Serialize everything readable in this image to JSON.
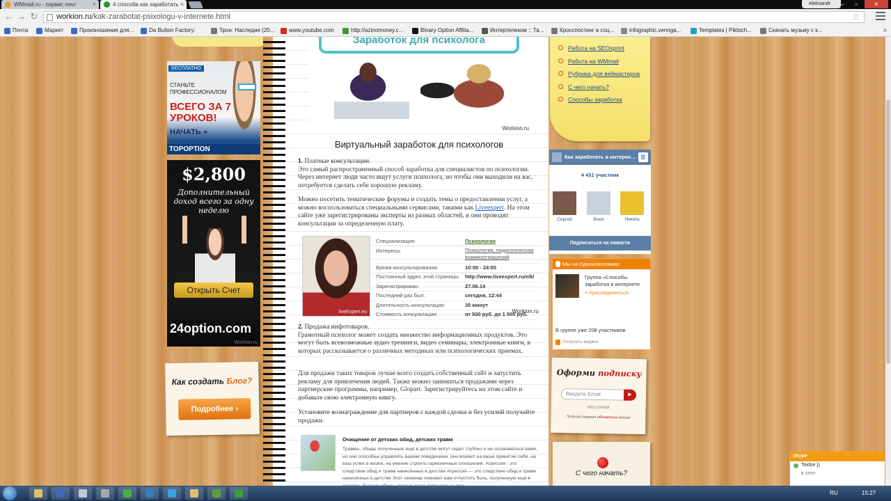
{
  "browser": {
    "tabs": [
      {
        "label": "WMmail.ru - сервис почт",
        "fav_color": "#e8a030"
      },
      {
        "label": "4 способа как заработать",
        "fav_color": "#2a9a2a"
      }
    ],
    "user": "Aleksandr",
    "window_buttons": [
      "—",
      "▫",
      "✕"
    ],
    "url_domain": "workion.ru",
    "url_path": "/kak-zarabotat-psixologu-v-internete.html",
    "bookmarks": [
      {
        "label": "Почта",
        "color": "#3b6cb8"
      },
      {
        "label": "Маркет",
        "color": "#3b6cb8"
      },
      {
        "label": "Произношения для...",
        "color": "#3b6cb8"
      },
      {
        "label": "Da Button Factory:",
        "color": "#3b6cb8"
      },
      {
        "label": "Трон: Наследие (20...",
        "color": "#777777"
      },
      {
        "label": "www.youtube.com",
        "color": "#d82a20"
      },
      {
        "label": "http://azinomoney.c...",
        "color": "#3a9a3a"
      },
      {
        "label": "Binary Option Affilia...",
        "color": "#111111"
      },
      {
        "label": "Интертелеком :: Та...",
        "color": "#555555"
      },
      {
        "label": "Кросспостинг в соц...",
        "color": "#777777"
      },
      {
        "label": "infographic.vennga...",
        "color": "#888888"
      },
      {
        "label": "Templates | Piktoch...",
        "color": "#20a0c0"
      },
      {
        "label": "Скачать музыку с к...",
        "color": "#777777"
      }
    ],
    "bookmarks_more": "»"
  },
  "left": {
    "edu_banner": {
      "tag": "БЕСПЛАТНО",
      "line1": "СТАНЬТЕ ПРОФЕССИОНАЛОМ",
      "line2": "ВСЕГО ЗА 7 УРОКОВ!",
      "line3": "НАЧАТЬ »",
      "logo": "TOPOPTION"
    },
    "option_banner": {
      "amount": "$2,800",
      "sub": "Дополнительный доход всего за одну неделю",
      "button": "Открыть Счет",
      "logo": "24option.com",
      "watermark": "Workion.ru"
    },
    "blog_note": {
      "title_a": "Как создать ",
      "title_b": "Блог?",
      "button": "Подробнее ›"
    }
  },
  "hero": {
    "sign": "Заработок для психолога",
    "caption": "Workion.ru"
  },
  "article": {
    "title": "Виртуальный заработок для психологов",
    "s1_num": "1.",
    "s1_head": " Платные консультации.",
    "s1_text": "Это самый распространенный способ заработка для специалистов по психологии. Через интернет люди часто ищут услуги психолога, но чтобы они выходили на вас, потребуется сделать себе хорошую рекламу.",
    "p2_a": "Можно посетить тематические форумы и создать темы о предоставлении услуг, а можно воспользоваться специальными сервисами, такими как ",
    "p2_link": "Liveexpert",
    "p2_b": ". На этом сайте уже зарегистрированы эксперты из разных областей, и они проводят консультации за определенную плату.",
    "s2_num": "2.",
    "s2_head": " Продажа инфотоваров.",
    "s2_text": "Грамотный психолог может создать множество информационных продуктов. Это могут быть всевозможные аудио тренинги, видео семинары, электронные книги, в которых рассказывается о различных методиках или психологических приемах.",
    "p4": "Для продажи таких товаров лучше всего создать собственный сайт и запустить рекламу для привлечения людей. Также можно заниматься продажами через партнерские программы, например, Glopart. Зарегистрируйтесь на этом сайте и добавьте свою электронную книгу.",
    "p5": "Установите вознаграждение для партнеров с каждой сделки и без усилий получайте продажи."
  },
  "profile": {
    "photo_label": "liveExpert.eu",
    "watermark": "Workion.ru",
    "rows": [
      {
        "k": "Специализация:",
        "v": "Психология"
      },
      {
        "k": "Интересы:",
        "v": "Психология, педагогическая взаимоотношений"
      },
      {
        "k": "Время консультирования:",
        "v": "10:00 - 24:00"
      },
      {
        "k": "Постоянный адрес этой страницы:",
        "v": "http://www.liveexpert.ru/e/kl"
      },
      {
        "k": "Зарегистрирован:",
        "v": "27.06.14"
      },
      {
        "k": "Последний раз был:",
        "v": "сегодня, 12:44"
      },
      {
        "k": "Длительность консультации:",
        "v": "30 минут"
      },
      {
        "k": "Стоимость консультации:",
        "v": "от 500 руб. до 1 000 руб."
      }
    ]
  },
  "ad": {
    "heading": "Очищение от детских обид, детских травм",
    "text": "Травмы, обиды полученные ещё в детстве могут сидит глубоко и не осознаваться вами, но они способны управлять вашим поведением, они влияют на ваше принятие себя, на ваш успех в жизни, на умение строить гармоничные отношения. Агрессия - это следствие обид и травм нанесённых в детстве Агрессия — это следствие обид и травм нанесённых в детстве Этот семинар поможет вам отпустить боль, полученную ещё в детстве. Детские обиды откладывают отпечаток на всю"
  },
  "right": {
    "menu": [
      "Работа на SEOsprint",
      "Работа на WMmail",
      "Рубрика для вебмастеров",
      "С чего начать?",
      "Способы заработка"
    ],
    "vk": {
      "title": "Как заработать в интерне...",
      "logo": "В",
      "count": "4 431 участник",
      "members": [
        {
          "name": "Сергей",
          "color": "#7a5a4a"
        },
        {
          "name": "Вася",
          "color": "#c9d2dc"
        },
        {
          "name": "Никита",
          "color": "#e9c030"
        }
      ],
      "join": "Подписаться на новости"
    },
    "ok": {
      "title": "Мы на Одноклассниках",
      "group": "Группа «Способы заработка в интернете",
      "join": "+ присоединиться",
      "count": "В группе уже 208 участников",
      "widget": "Получить виджет"
    },
    "subscribe": {
      "title_a": "Оформи ",
      "title_b": "подписку",
      "placeholder": "Введите Email",
      "button": "▶",
      "spam": "БЕЗ СПАМА",
      "note_a": "Получай первым ",
      "note_b": "обновления",
      "note_c": " блога!"
    },
    "start_note": "С чего начать?"
  },
  "skype": {
    "title": "Skype",
    "rows": [
      "Toidze ))",
      "в сети"
    ]
  },
  "taskbar": {
    "apps": [
      "#e0c060",
      "#3a6ab8",
      "#c0c8d0",
      "#a0a8b0",
      "#4ab040",
      "#3080c0",
      "#3aa0e0",
      "#e0c070",
      "#5aa03a",
      "#3aa03a",
      "#d0d0d0"
    ],
    "lang": "RU",
    "time": "15:27"
  }
}
